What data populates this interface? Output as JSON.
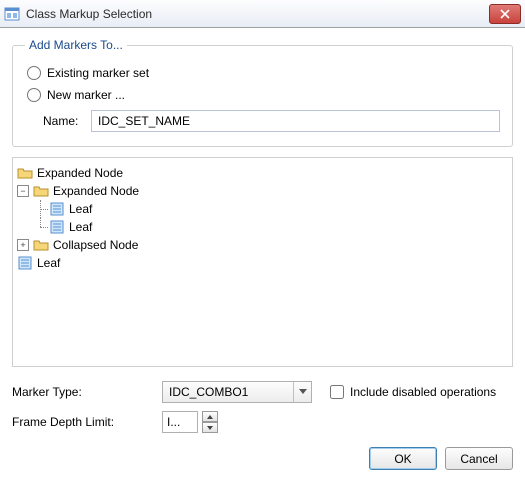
{
  "window": {
    "title": "Class Markup Selection"
  },
  "group": {
    "legend": "Add Markers To...",
    "radio_existing": "Existing marker set",
    "radio_new": "New marker ...",
    "name_label": "Name:",
    "name_value": "IDC_SET_NAME"
  },
  "tree": {
    "root1": "Expanded Node",
    "child1": "Expanded Node",
    "leaf1": "Leaf",
    "leaf2": "Leaf",
    "child2": "Collapsed Node",
    "root_leaf": "Leaf"
  },
  "marker_type": {
    "label": "Marker Type:",
    "value": "IDC_COMBO1"
  },
  "include_disabled": {
    "label": "Include disabled operations",
    "checked": false
  },
  "frame_depth": {
    "label": "Frame Depth Limit:",
    "value": "I..."
  },
  "buttons": {
    "ok": "OK",
    "cancel": "Cancel"
  }
}
